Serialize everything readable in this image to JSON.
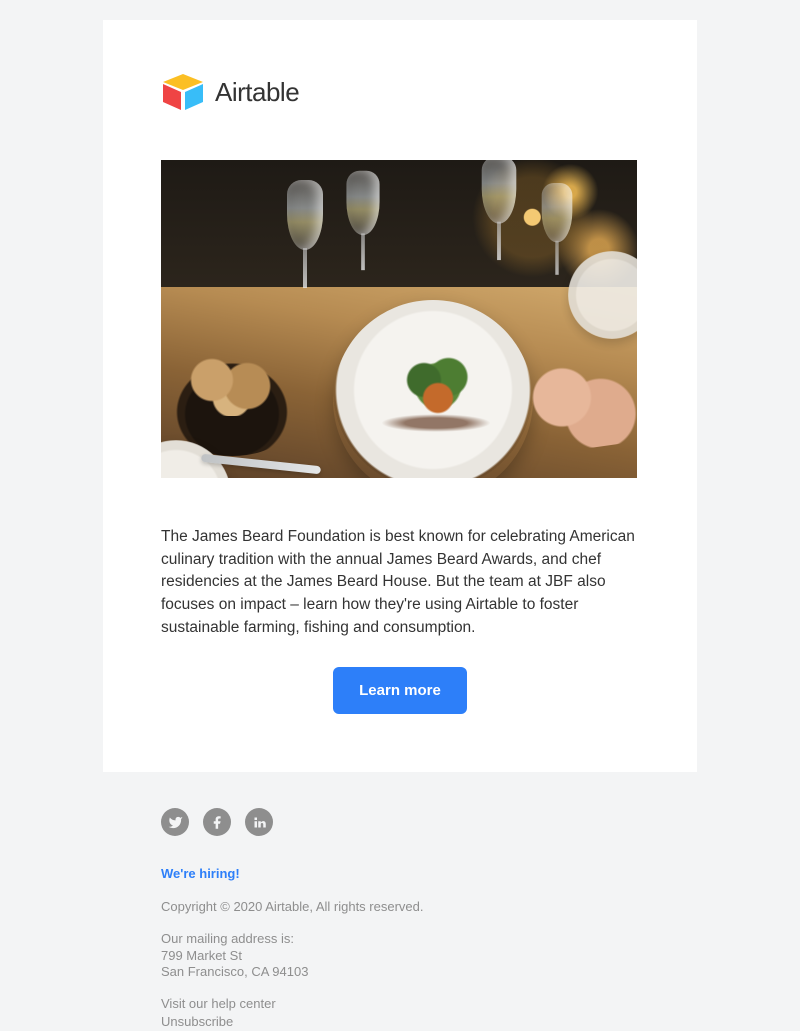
{
  "header": {
    "brand": "Airtable"
  },
  "main": {
    "body": "The James Beard Foundation is best known for celebrating American culinary tradition with the annual James Beard Awards, and chef residencies at the James Beard House. But the team at JBF also focuses on impact – learn how they're using Airtable to foster sustainable farming, fishing and consumption.",
    "cta_label": "Learn more"
  },
  "footer": {
    "hiring": "We're hiring!",
    "copyright": "Copyright © 2020 Airtable, All rights reserved.",
    "address_label": "Our mailing address is:",
    "address_line1": "799 Market St",
    "address_line2": "San Francisco, CA 94103",
    "help_link": "Visit our help center",
    "unsubscribe": "Unsubscribe"
  }
}
